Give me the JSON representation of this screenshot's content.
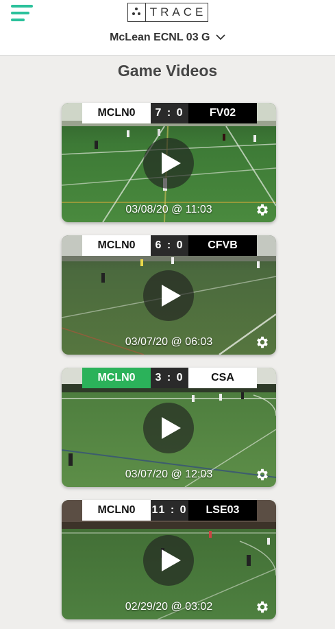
{
  "header": {
    "logo_text": "TRACE",
    "team_name": "McLean ECNL 03 G",
    "menu_icon": "hamburger-menu-icon",
    "dropdown_icon": "chevron-down-icon",
    "accent_color": "#2bc19b"
  },
  "page_title": "Game Videos",
  "videos": [
    {
      "home": "MCLN0",
      "score": "7 : 0",
      "away": "FV02",
      "date": "03/08/20 @ 11:03",
      "home_win_color": false,
      "away_light": false
    },
    {
      "home": "MCLN0",
      "score": "6 : 0",
      "away": "CFVB",
      "date": "03/07/20 @ 06:03",
      "home_win_color": false,
      "away_light": false
    },
    {
      "home": "MCLN0",
      "score": "3 : 0",
      "away": "CSA",
      "date": "03/07/20 @ 12:03",
      "home_win_color": true,
      "away_light": true
    },
    {
      "home": "MCLN0",
      "score": "11 : 0",
      "away": "LSE03",
      "date": "02/29/20 @ 03:02",
      "home_win_color": false,
      "away_light": false
    }
  ]
}
